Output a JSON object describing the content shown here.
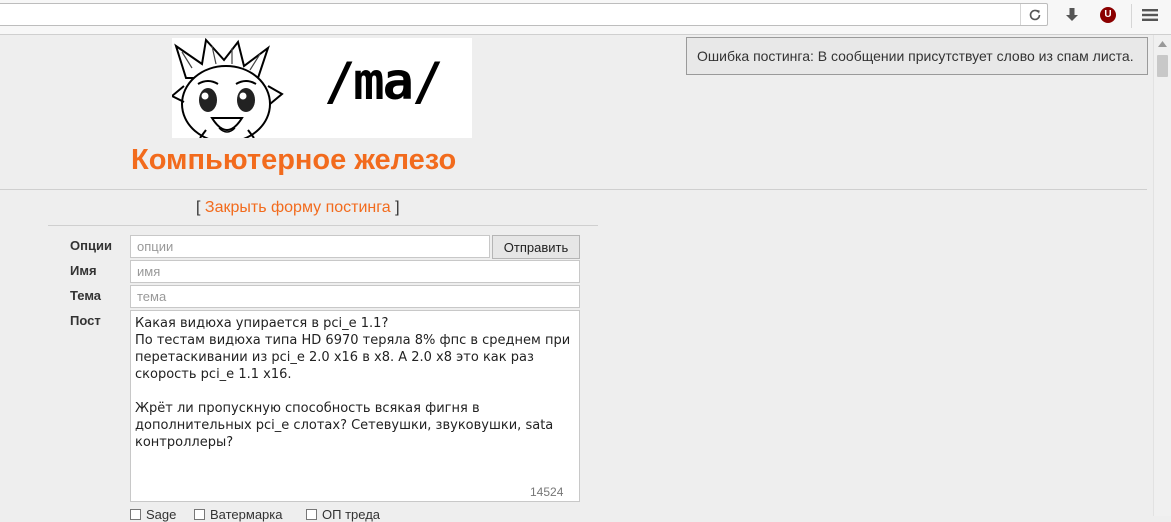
{
  "browser": {
    "url": "",
    "reload_icon": "reload-icon",
    "download_icon": "download-arrow-icon",
    "ublock_label": "U",
    "menu_icon": "hamburger-menu-icon"
  },
  "notification": {
    "text": "Ошибка постинга: В сообщении присутствует слово из спам листа."
  },
  "board": {
    "logo_text": "/ma/",
    "title": "Компьютерное железо"
  },
  "form_toggle": {
    "open_bracket": "[",
    "link": "Закрыть форму постинга",
    "close_bracket": "]"
  },
  "form": {
    "options_label": "Опции",
    "options_placeholder": "опции",
    "submit_label": "Отправить",
    "name_label": "Имя",
    "name_placeholder": "имя",
    "subject_label": "Тема",
    "subject_placeholder": "тема",
    "post_label": "Пост",
    "post_lines": [
      "Какая видюха упирается в pci_e 1.1?",
      "По тестам видюха типа HD 6970 теряла 8% фпс в среднем при",
      "перетаскивании из pci_e 2.0 x16 в x8. А 2.0 x8 это как раз",
      "скорость pci_e 1.1 x16.",
      "",
      "Жрёт ли пропускную способность всякая фигня в",
      "дополнительных pci_e слотах? Сетевушки, звуковушки, sata",
      "контроллеры?"
    ],
    "char_counter": "14524",
    "checkboxes": [
      {
        "label": "Sage",
        "checked": false
      },
      {
        "label": "Ватермарка",
        "checked": false
      },
      {
        "label": "ОП треда",
        "checked": false
      }
    ]
  },
  "colors": {
    "accent": "#f26b1d",
    "background": "#eeeeee"
  }
}
